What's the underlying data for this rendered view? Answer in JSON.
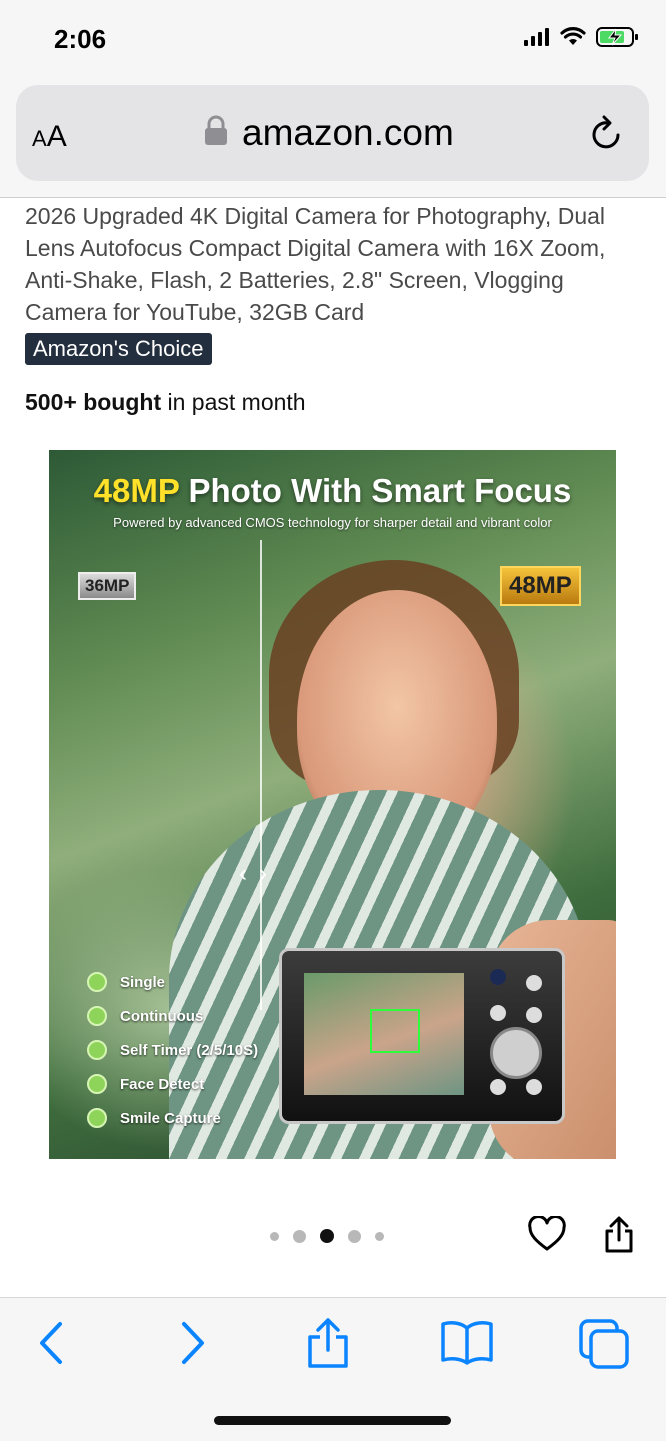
{
  "status": {
    "time": "2:06"
  },
  "browser": {
    "text_size_label_small": "A",
    "text_size_label_large": "A",
    "domain": "amazon.com"
  },
  "product": {
    "title": "2026 Upgraded 4K Digital Camera for Photography, Dual Lens Autofocus Compact Digital Camera with 16X Zoom, Anti-Shake, Flash, 2 Batteries, 2.8\" Screen, Vlogging Camera for YouTube, 32GB Card",
    "badge": "Amazon's Choice",
    "bought_count": "500+ bought",
    "bought_suffix": " in past month",
    "image": {
      "headline_highlight": "48MP",
      "headline_rest": " Photo With Smart Focus",
      "subheadline": "Powered by advanced CMOS technology for sharper detail and vibrant color",
      "tag_left": "36MP",
      "tag_right": "48MP",
      "features": [
        "Single",
        "Continuous",
        "Self Timer (2/5/10S)",
        "Face Detect",
        "Smile Capture"
      ]
    },
    "carousel": {
      "count": 5,
      "active_index": 2
    }
  },
  "colors": {
    "accent_blue": "#0a84ff",
    "badge_bg": "#232f3e",
    "headline_yellow": "#ffe12a"
  },
  "icons": {
    "lock": "lock-icon",
    "reload": "reload-icon",
    "heart": "heart-icon",
    "share": "share-icon",
    "back": "chevron-left-icon",
    "forward": "chevron-right-icon",
    "bookmarks": "book-icon",
    "tabs": "tabs-icon"
  }
}
